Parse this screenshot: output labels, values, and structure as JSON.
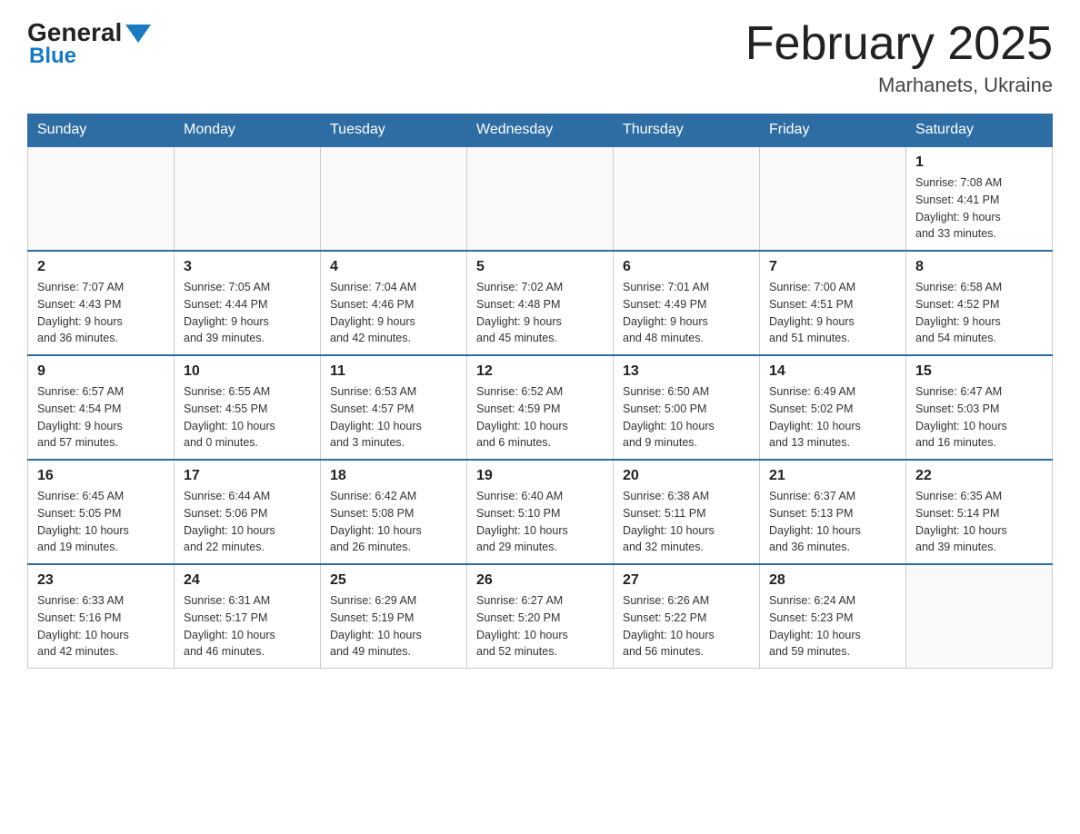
{
  "header": {
    "logo_general": "General",
    "logo_blue": "Blue",
    "month_title": "February 2025",
    "location": "Marhanets, Ukraine"
  },
  "days_of_week": [
    "Sunday",
    "Monday",
    "Tuesday",
    "Wednesday",
    "Thursday",
    "Friday",
    "Saturday"
  ],
  "weeks": [
    [
      {
        "day": "",
        "info": ""
      },
      {
        "day": "",
        "info": ""
      },
      {
        "day": "",
        "info": ""
      },
      {
        "day": "",
        "info": ""
      },
      {
        "day": "",
        "info": ""
      },
      {
        "day": "",
        "info": ""
      },
      {
        "day": "1",
        "info": "Sunrise: 7:08 AM\nSunset: 4:41 PM\nDaylight: 9 hours\nand 33 minutes."
      }
    ],
    [
      {
        "day": "2",
        "info": "Sunrise: 7:07 AM\nSunset: 4:43 PM\nDaylight: 9 hours\nand 36 minutes."
      },
      {
        "day": "3",
        "info": "Sunrise: 7:05 AM\nSunset: 4:44 PM\nDaylight: 9 hours\nand 39 minutes."
      },
      {
        "day": "4",
        "info": "Sunrise: 7:04 AM\nSunset: 4:46 PM\nDaylight: 9 hours\nand 42 minutes."
      },
      {
        "day": "5",
        "info": "Sunrise: 7:02 AM\nSunset: 4:48 PM\nDaylight: 9 hours\nand 45 minutes."
      },
      {
        "day": "6",
        "info": "Sunrise: 7:01 AM\nSunset: 4:49 PM\nDaylight: 9 hours\nand 48 minutes."
      },
      {
        "day": "7",
        "info": "Sunrise: 7:00 AM\nSunset: 4:51 PM\nDaylight: 9 hours\nand 51 minutes."
      },
      {
        "day": "8",
        "info": "Sunrise: 6:58 AM\nSunset: 4:52 PM\nDaylight: 9 hours\nand 54 minutes."
      }
    ],
    [
      {
        "day": "9",
        "info": "Sunrise: 6:57 AM\nSunset: 4:54 PM\nDaylight: 9 hours\nand 57 minutes."
      },
      {
        "day": "10",
        "info": "Sunrise: 6:55 AM\nSunset: 4:55 PM\nDaylight: 10 hours\nand 0 minutes."
      },
      {
        "day": "11",
        "info": "Sunrise: 6:53 AM\nSunset: 4:57 PM\nDaylight: 10 hours\nand 3 minutes."
      },
      {
        "day": "12",
        "info": "Sunrise: 6:52 AM\nSunset: 4:59 PM\nDaylight: 10 hours\nand 6 minutes."
      },
      {
        "day": "13",
        "info": "Sunrise: 6:50 AM\nSunset: 5:00 PM\nDaylight: 10 hours\nand 9 minutes."
      },
      {
        "day": "14",
        "info": "Sunrise: 6:49 AM\nSunset: 5:02 PM\nDaylight: 10 hours\nand 13 minutes."
      },
      {
        "day": "15",
        "info": "Sunrise: 6:47 AM\nSunset: 5:03 PM\nDaylight: 10 hours\nand 16 minutes."
      }
    ],
    [
      {
        "day": "16",
        "info": "Sunrise: 6:45 AM\nSunset: 5:05 PM\nDaylight: 10 hours\nand 19 minutes."
      },
      {
        "day": "17",
        "info": "Sunrise: 6:44 AM\nSunset: 5:06 PM\nDaylight: 10 hours\nand 22 minutes."
      },
      {
        "day": "18",
        "info": "Sunrise: 6:42 AM\nSunset: 5:08 PM\nDaylight: 10 hours\nand 26 minutes."
      },
      {
        "day": "19",
        "info": "Sunrise: 6:40 AM\nSunset: 5:10 PM\nDaylight: 10 hours\nand 29 minutes."
      },
      {
        "day": "20",
        "info": "Sunrise: 6:38 AM\nSunset: 5:11 PM\nDaylight: 10 hours\nand 32 minutes."
      },
      {
        "day": "21",
        "info": "Sunrise: 6:37 AM\nSunset: 5:13 PM\nDaylight: 10 hours\nand 36 minutes."
      },
      {
        "day": "22",
        "info": "Sunrise: 6:35 AM\nSunset: 5:14 PM\nDaylight: 10 hours\nand 39 minutes."
      }
    ],
    [
      {
        "day": "23",
        "info": "Sunrise: 6:33 AM\nSunset: 5:16 PM\nDaylight: 10 hours\nand 42 minutes."
      },
      {
        "day": "24",
        "info": "Sunrise: 6:31 AM\nSunset: 5:17 PM\nDaylight: 10 hours\nand 46 minutes."
      },
      {
        "day": "25",
        "info": "Sunrise: 6:29 AM\nSunset: 5:19 PM\nDaylight: 10 hours\nand 49 minutes."
      },
      {
        "day": "26",
        "info": "Sunrise: 6:27 AM\nSunset: 5:20 PM\nDaylight: 10 hours\nand 52 minutes."
      },
      {
        "day": "27",
        "info": "Sunrise: 6:26 AM\nSunset: 5:22 PM\nDaylight: 10 hours\nand 56 minutes."
      },
      {
        "day": "28",
        "info": "Sunrise: 6:24 AM\nSunset: 5:23 PM\nDaylight: 10 hours\nand 59 minutes."
      },
      {
        "day": "",
        "info": ""
      }
    ]
  ]
}
